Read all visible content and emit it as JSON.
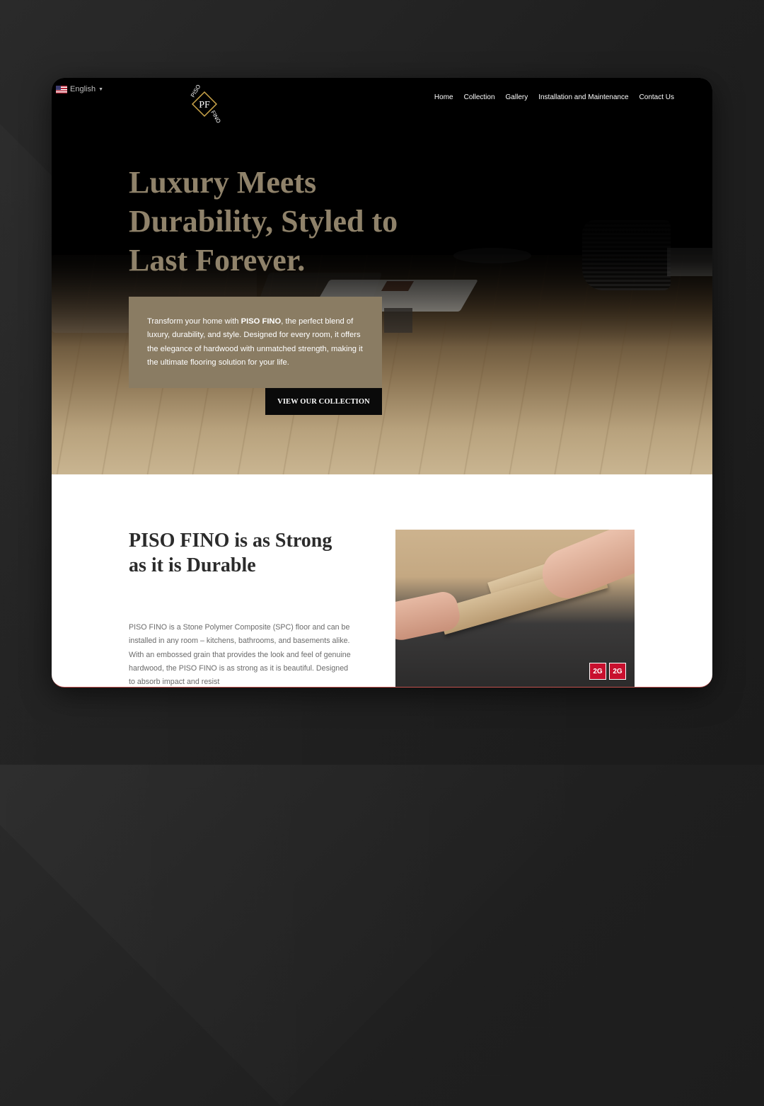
{
  "language": {
    "label": "English"
  },
  "logo": {
    "top": "PISO",
    "mono": "PF",
    "bottom": "FINO"
  },
  "nav": {
    "items": [
      {
        "label": "Home"
      },
      {
        "label": "Collection"
      },
      {
        "label": "Gallery"
      },
      {
        "label": "Installation and Maintenance"
      },
      {
        "label": "Contact Us"
      }
    ]
  },
  "hero": {
    "title": "Luxury Meets Durability, Styled to Last Forever.",
    "intro_before": "Transform your home with ",
    "intro_brand": "PISO FINO",
    "intro_after": ", the perfect blend of luxury, durability, and style. Designed for every room, it offers the elegance of hardwood with unmatched strength, making it the ultimate flooring solution for your life.",
    "cta_label": "VIEW OUR COLLECTION"
  },
  "section": {
    "title": "PISO FINO is as Strong as it is Durable",
    "body": "PISO FINO is a Stone Polymer Composite (SPC) floor and can be installed in any room – kitchens, bathrooms, and basements alike. With an embossed grain that provides the look and feel of genuine hardwood, the PISO FINO is as strong as it is beautiful. Designed to absorb impact and resist",
    "badges": [
      "2G",
      "2G"
    ]
  },
  "colors": {
    "accent_gold": "#8f826a",
    "box_bg": "#8a7c63",
    "cta_bg": "#0a0a0a"
  }
}
